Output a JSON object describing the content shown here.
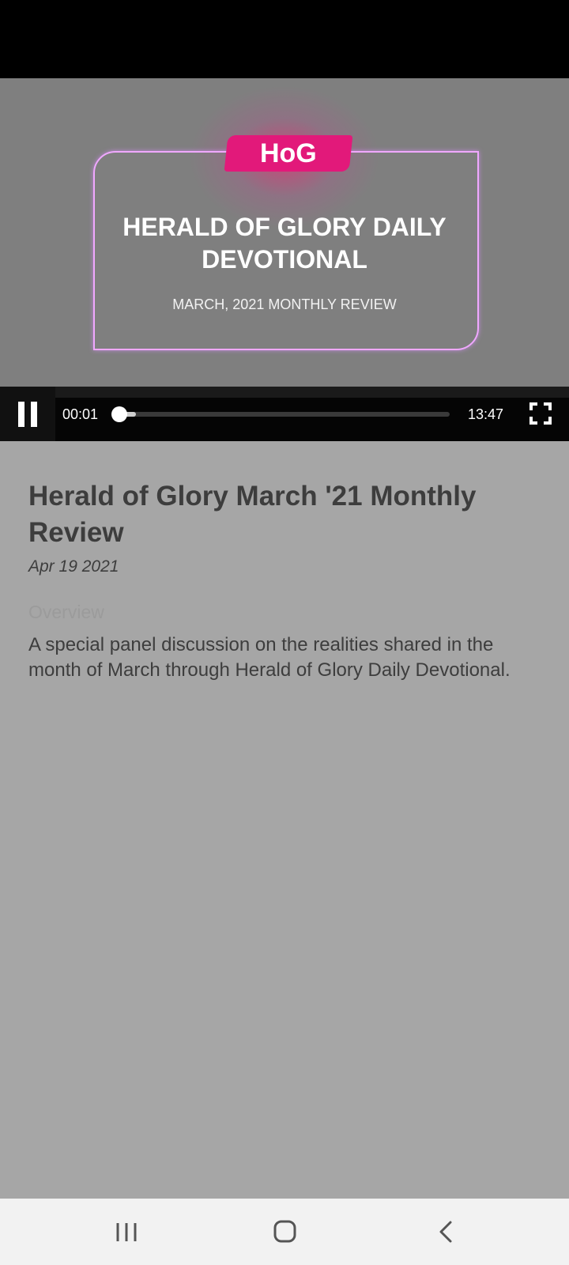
{
  "video": {
    "badge": "HoG",
    "title": "HERALD OF GLORY DAILY DEVOTIONAL",
    "subtitle": "MARCH, 2021 MONTHLY REVIEW",
    "current_time": "00:01",
    "total_time": "13:47",
    "progress_fraction": 0.001,
    "accent_color": "#e2197a",
    "frame_color": "#f0a8ff"
  },
  "controls": {
    "play_state_icon": "pause-icon",
    "fullscreen_icon": "fullscreen-icon"
  },
  "episode": {
    "title": "Herald of Glory March '21 Monthly Review",
    "date": "Apr 19 2021",
    "overview_label": "Overview",
    "overview_text": "A special panel discussion on the realities shared in the month of March through Herald of Glory Daily Devotional."
  },
  "nav": {
    "recents_icon": "recents-icon",
    "home_icon": "home-icon",
    "back_icon": "back-icon"
  }
}
